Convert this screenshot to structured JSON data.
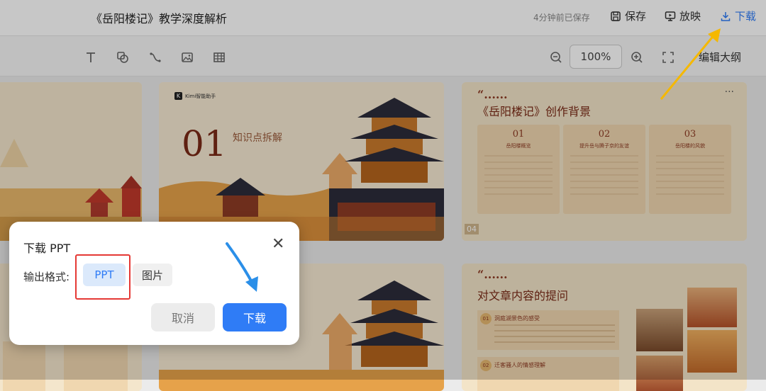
{
  "header": {
    "title": "《岳阳楼记》教学深度解析",
    "saved_status": "4分钟前已保存",
    "save_label": "保存",
    "present_label": "放映",
    "download_label": "下载"
  },
  "toolbar": {
    "tools": [
      "text-tool-icon",
      "shape-tool-icon",
      "line-tool-icon",
      "image-tool-icon",
      "table-tool-icon"
    ],
    "zoom_value": "100%",
    "outline_label": "编辑大纲"
  },
  "slides": {
    "s2": {
      "brand": "Kimi智能助手",
      "number": "01",
      "subtitle": "知识点拆解"
    },
    "s3": {
      "quote": "“......",
      "title": "《岳阳楼记》创作背景",
      "cols": [
        {
          "num": "01",
          "head": "岳阳楼概览"
        },
        {
          "num": "02",
          "head": "提升岳与腾子京的友谊"
        },
        {
          "num": "03",
          "head": "岳阳楼的风貌"
        }
      ],
      "badge": "04"
    },
    "s6": {
      "quote": "“......",
      "title": "对文章内容的提问",
      "items": [
        {
          "num": "01",
          "head": "洞庭湖景色的感受"
        },
        {
          "num": "02",
          "head": "迁客骚人的情感理解"
        }
      ]
    }
  },
  "dialog": {
    "title": "下载 PPT",
    "format_label": "输出格式:",
    "options": [
      "PPT",
      "图片"
    ],
    "selected": "PPT",
    "cancel_label": "取消",
    "confirm_label": "下载"
  },
  "colors": {
    "accent": "#2f7cf6",
    "highlight": "#e53935",
    "slide_bg": "#f4e6cc",
    "arrow_yellow": "#f5b800"
  }
}
